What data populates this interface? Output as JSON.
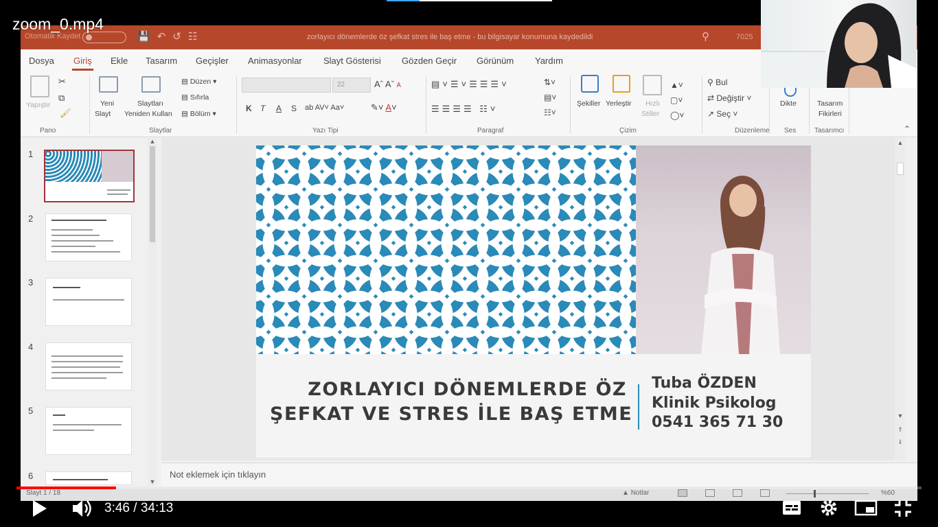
{
  "video": {
    "title": "zoom_0.mp4",
    "current_time": "3:46",
    "duration": "34:13",
    "time_display": "3:46 / 34:13",
    "progress_fraction": 0.11
  },
  "ppt": {
    "titlebar": {
      "autosave_label": "Otomatik Kaydet",
      "document_title": "zorlayıcı dönemlerde öz şefkat stres ile baş etme  -  bu bilgisayar konumuna kaydedildi",
      "counter": "7025"
    },
    "tabs": [
      "Dosya",
      "Giriş",
      "Ekle",
      "Tasarım",
      "Geçişler",
      "Animasyonlar",
      "Slayt Gösterisi",
      "Gözden Geçir",
      "Görünüm",
      "Yardım"
    ],
    "active_tab": "Giriş",
    "ribbon": {
      "pano": {
        "label": "Pano",
        "paste": "Yapıştır"
      },
      "slaytlar": {
        "label": "Slaytlar",
        "new_slide": "Yeni",
        "new_slide2": "Slayt",
        "reuse": "Slaytları",
        "reuse2": "Yeniden Kullan",
        "layout": "Düzen",
        "reset": "Sıfırla",
        "section": "Bölüm"
      },
      "yazi_tipi": {
        "label": "Yazı Tipi",
        "bold": "K",
        "italic": "T",
        "underline": "A",
        "strike": "S",
        "font_size": "22"
      },
      "paragraf": {
        "label": "Paragraf"
      },
      "cizim": {
        "label": "Çizim",
        "shapes": "Şekiller",
        "arrange": "Yerleştir",
        "quick_styles": "Hızlı",
        "quick_styles2": "Stiller"
      },
      "duzenleme": {
        "label": "Düzenleme",
        "find": "Bul",
        "replace": "Değiştir",
        "select": "Seç"
      },
      "ses": {
        "label": "Ses",
        "dictate": "Dikte"
      },
      "tasarimci": {
        "label": "Tasarımcı",
        "design_ideas": "Tasarım",
        "design_ideas2": "Fikirleri"
      }
    },
    "slide_numbers": [
      "1",
      "2",
      "3",
      "4",
      "5",
      "6"
    ],
    "slide": {
      "title_line1": "ZORLAYICI DÖNEMLERDE ÖZ",
      "title_line2": "ŞEFKAT VE  STRES İLE BAŞ ETME",
      "name": "Tuba ÖZDEN",
      "role": "Klinik Psikolog",
      "phone": "0541 365 71 30"
    },
    "notes_placeholder": "Not eklemek için tıklayın",
    "statusbar": {
      "slide_info": "Slayt 1 / 18",
      "notes_button": "Notlar",
      "zoom": "%60"
    }
  },
  "colors": {
    "ppt_accent": "#b7472a",
    "slide_blue": "#2a8ab8",
    "progress_red": "#ff0000"
  }
}
